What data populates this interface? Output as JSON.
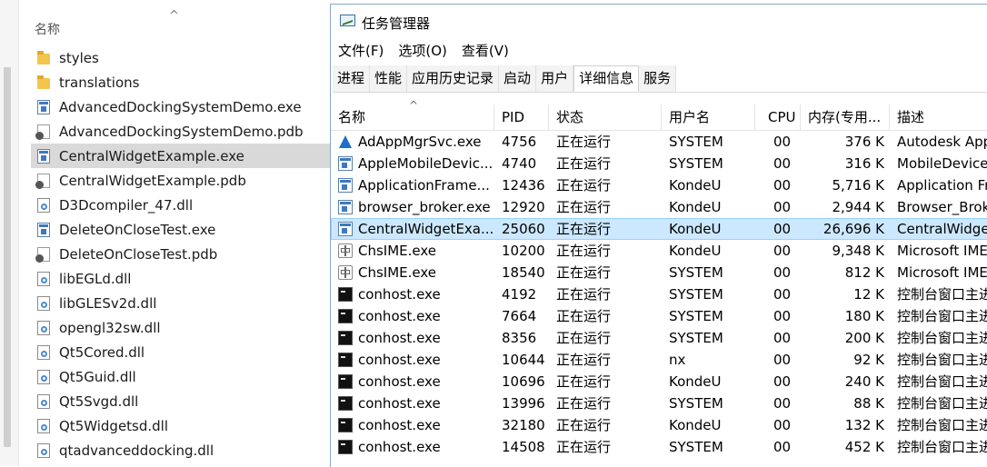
{
  "explorer": {
    "column_header": "名称",
    "files": [
      {
        "name": "styles",
        "type": "folder"
      },
      {
        "name": "translations",
        "type": "folder"
      },
      {
        "name": "AdvancedDockingSystemDemo.exe",
        "type": "exe"
      },
      {
        "name": "AdvancedDockingSystemDemo.pdb",
        "type": "pdb"
      },
      {
        "name": "CentralWidgetExample.exe",
        "type": "exe",
        "selected": true
      },
      {
        "name": "CentralWidgetExample.pdb",
        "type": "pdb"
      },
      {
        "name": "D3Dcompiler_47.dll",
        "type": "dll"
      },
      {
        "name": "DeleteOnCloseTest.exe",
        "type": "exe"
      },
      {
        "name": "DeleteOnCloseTest.pdb",
        "type": "pdb"
      },
      {
        "name": "libEGLd.dll",
        "type": "dll"
      },
      {
        "name": "libGLESv2d.dll",
        "type": "dll"
      },
      {
        "name": "opengl32sw.dll",
        "type": "dll"
      },
      {
        "name": "Qt5Cored.dll",
        "type": "dll"
      },
      {
        "name": "Qt5Guid.dll",
        "type": "dll"
      },
      {
        "name": "Qt5Svgd.dll",
        "type": "dll"
      },
      {
        "name": "Qt5Widgetsd.dll",
        "type": "dll"
      },
      {
        "name": "qtadvanceddocking.dll",
        "type": "dll"
      }
    ]
  },
  "taskmgr": {
    "title": "任务管理器",
    "menu": [
      "文件(F)",
      "选项(O)",
      "查看(V)"
    ],
    "tabs": [
      {
        "label": "进程"
      },
      {
        "label": "性能"
      },
      {
        "label": "应用历史记录"
      },
      {
        "label": "启动"
      },
      {
        "label": "用户"
      },
      {
        "label": "详细信息",
        "active": true
      },
      {
        "label": "服务"
      }
    ],
    "columns": {
      "name": "名称",
      "pid": "PID",
      "status": "状态",
      "user": "用户名",
      "cpu": "CPU",
      "memory": "内存(专用...",
      "description": "描述"
    },
    "rows": [
      {
        "icon": "autodesk",
        "name": "AdAppMgrSvc.exe",
        "pid": "4756",
        "status": "正在运行",
        "user": "SYSTEM",
        "cpu": "00",
        "memory": "376 K",
        "description": "Autodesk App"
      },
      {
        "icon": "app",
        "name": "AppleMobileDevic...",
        "pid": "4740",
        "status": "正在运行",
        "user": "SYSTEM",
        "cpu": "00",
        "memory": "316 K",
        "description": "MobileDevice"
      },
      {
        "icon": "app",
        "name": "ApplicationFrame...",
        "pid": "12436",
        "status": "正在运行",
        "user": "KondeU",
        "cpu": "00",
        "memory": "5,716 K",
        "description": "Application Fr"
      },
      {
        "icon": "app",
        "name": "browser_broker.exe",
        "pid": "12920",
        "status": "正在运行",
        "user": "KondeU",
        "cpu": "00",
        "memory": "2,944 K",
        "description": "Browser_Brok"
      },
      {
        "icon": "app",
        "name": "CentralWidgetExa...",
        "pid": "25060",
        "status": "正在运行",
        "user": "KondeU",
        "cpu": "00",
        "memory": "26,696 K",
        "description": "CentralWidge",
        "selected": true
      },
      {
        "icon": "ime",
        "name": "ChsIME.exe",
        "pid": "10200",
        "status": "正在运行",
        "user": "KondeU",
        "cpu": "00",
        "memory": "9,348 K",
        "description": "Microsoft IME"
      },
      {
        "icon": "ime",
        "name": "ChsIME.exe",
        "pid": "18540",
        "status": "正在运行",
        "user": "SYSTEM",
        "cpu": "00",
        "memory": "812 K",
        "description": "Microsoft IME"
      },
      {
        "icon": "console",
        "name": "conhost.exe",
        "pid": "4192",
        "status": "正在运行",
        "user": "SYSTEM",
        "cpu": "00",
        "memory": "12 K",
        "description": "控制台窗口主进"
      },
      {
        "icon": "console",
        "name": "conhost.exe",
        "pid": "7664",
        "status": "正在运行",
        "user": "SYSTEM",
        "cpu": "00",
        "memory": "180 K",
        "description": "控制台窗口主进"
      },
      {
        "icon": "console",
        "name": "conhost.exe",
        "pid": "8356",
        "status": "正在运行",
        "user": "SYSTEM",
        "cpu": "00",
        "memory": "200 K",
        "description": "控制台窗口主进"
      },
      {
        "icon": "console",
        "name": "conhost.exe",
        "pid": "10644",
        "status": "正在运行",
        "user": "nx",
        "cpu": "00",
        "memory": "92 K",
        "description": "控制台窗口主进"
      },
      {
        "icon": "console",
        "name": "conhost.exe",
        "pid": "10696",
        "status": "正在运行",
        "user": "KondeU",
        "cpu": "00",
        "memory": "240 K",
        "description": "控制台窗口主进"
      },
      {
        "icon": "console",
        "name": "conhost.exe",
        "pid": "13996",
        "status": "正在运行",
        "user": "SYSTEM",
        "cpu": "00",
        "memory": "88 K",
        "description": "控制台窗口主进"
      },
      {
        "icon": "console",
        "name": "conhost.exe",
        "pid": "32180",
        "status": "正在运行",
        "user": "KondeU",
        "cpu": "00",
        "memory": "132 K",
        "description": "控制台窗口主进"
      },
      {
        "icon": "console",
        "name": "conhost.exe",
        "pid": "14508",
        "status": "正在运行",
        "user": "SYSTEM",
        "cpu": "00",
        "memory": "452 K",
        "description": "控制台窗口主进"
      }
    ]
  }
}
